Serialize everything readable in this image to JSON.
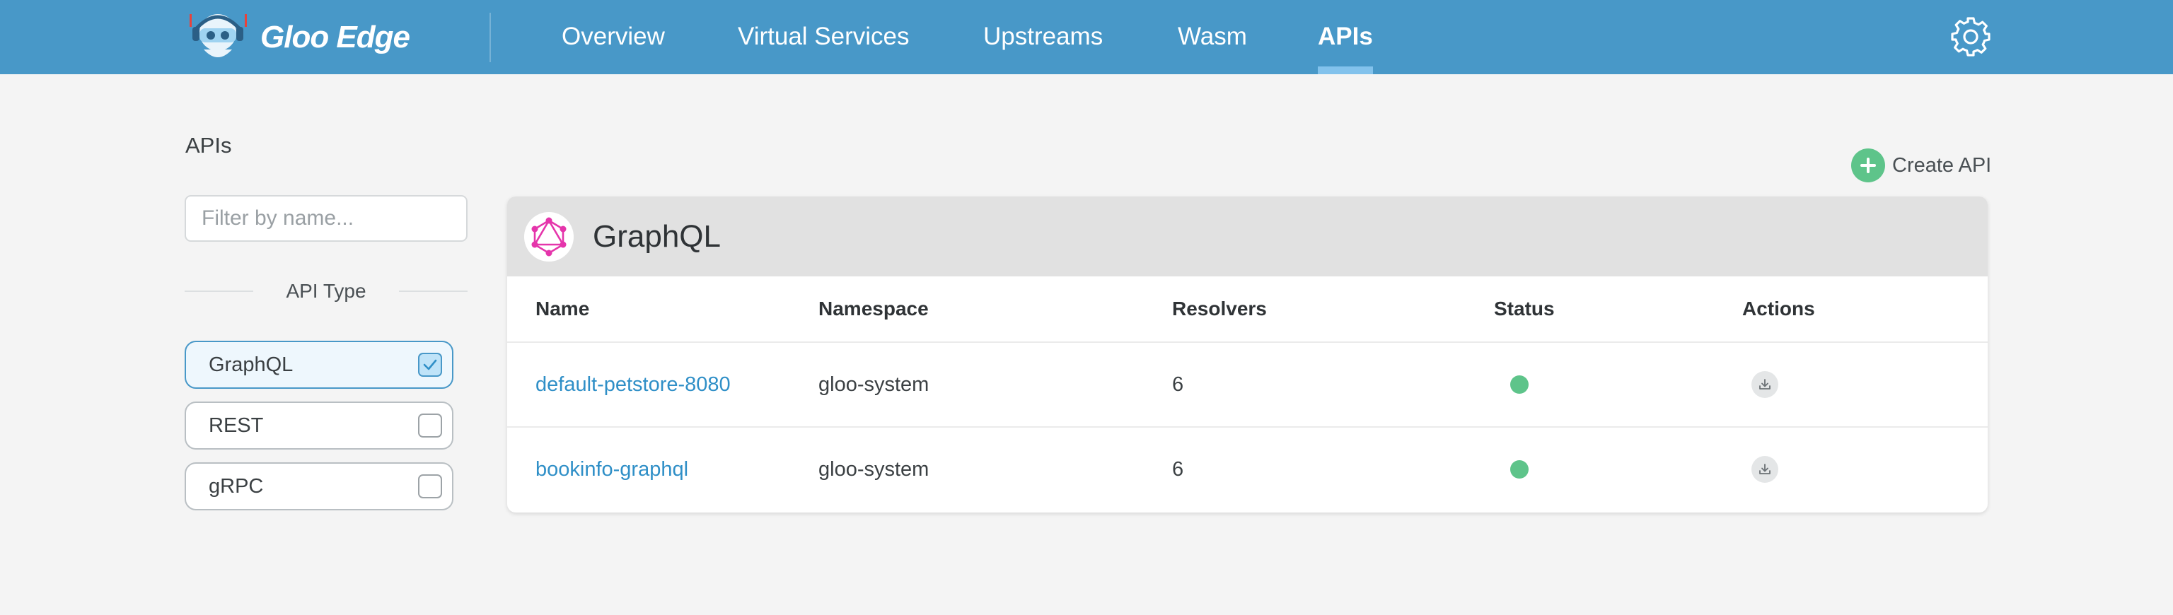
{
  "app": {
    "brand": "Gloo Edge",
    "colors": {
      "topbar": "#4898c8",
      "accent": "#2f8fc7",
      "success": "#5ec48a"
    }
  },
  "nav": {
    "items": [
      {
        "label": "Overview",
        "active": false
      },
      {
        "label": "Virtual Services",
        "active": false
      },
      {
        "label": "Upstreams",
        "active": false
      },
      {
        "label": "Wasm",
        "active": false
      },
      {
        "label": "APIs",
        "active": true
      }
    ],
    "settings_icon": "gear-icon"
  },
  "sidebar": {
    "title": "APIs",
    "filter": {
      "placeholder": "Filter by name...",
      "value": ""
    },
    "type_heading": "API Type",
    "types": [
      {
        "label": "GraphQL",
        "checked": true
      },
      {
        "label": "REST",
        "checked": false
      },
      {
        "label": "gRPC",
        "checked": false
      }
    ]
  },
  "actions": {
    "create_label": "Create API",
    "create_icon": "plus-circle-icon"
  },
  "card": {
    "title": "GraphQL",
    "icon": "graphql-logo-icon",
    "columns": [
      "Name",
      "Namespace",
      "Resolvers",
      "Status",
      "Actions"
    ],
    "rows": [
      {
        "name": "default-petstore-8080",
        "namespace": "gloo-system",
        "resolvers": "6",
        "status": "healthy",
        "action_icon": "download-icon"
      },
      {
        "name": "bookinfo-graphql",
        "namespace": "gloo-system",
        "resolvers": "6",
        "status": "healthy",
        "action_icon": "download-icon"
      }
    ]
  }
}
